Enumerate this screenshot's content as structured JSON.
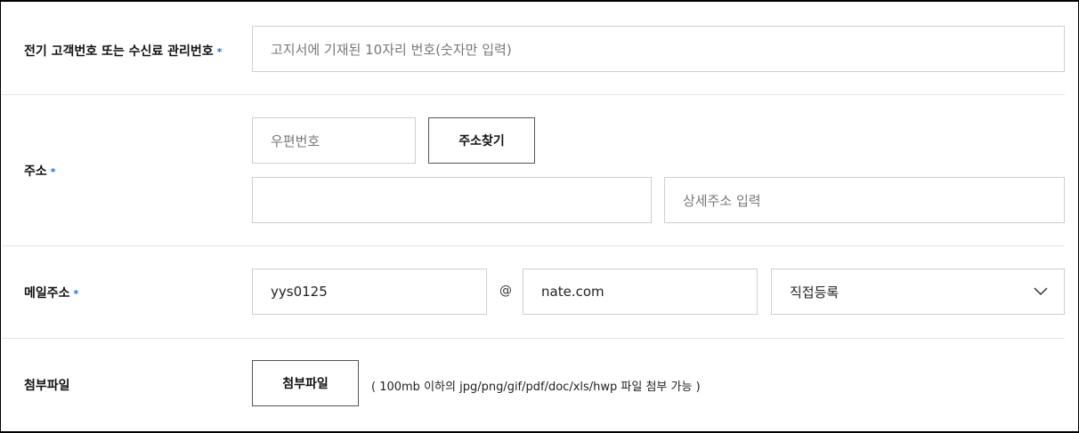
{
  "customer_number": {
    "label": "전기 고객번호 또는 수신료 관리번호",
    "required": "*",
    "placeholder": "고지서에 기재된 10자리 번호(숫자만 입력)"
  },
  "address": {
    "label": "주소",
    "required": "*",
    "zip_placeholder": "우편번호",
    "search_button": "주소찾기",
    "address_value": "",
    "detail_placeholder": "상세주소 입력"
  },
  "email": {
    "label": "메일주소",
    "required": "*",
    "local_value": "yys0125",
    "at": "@",
    "domain_value": "nate.com",
    "domain_select": "직접등록"
  },
  "attachment": {
    "label": "첨부파일",
    "button": "첨부파일",
    "note": "( 100mb 이하의 jpg/png/gif/pdf/doc/xls/hwp 파일 첨부 가능 )"
  }
}
